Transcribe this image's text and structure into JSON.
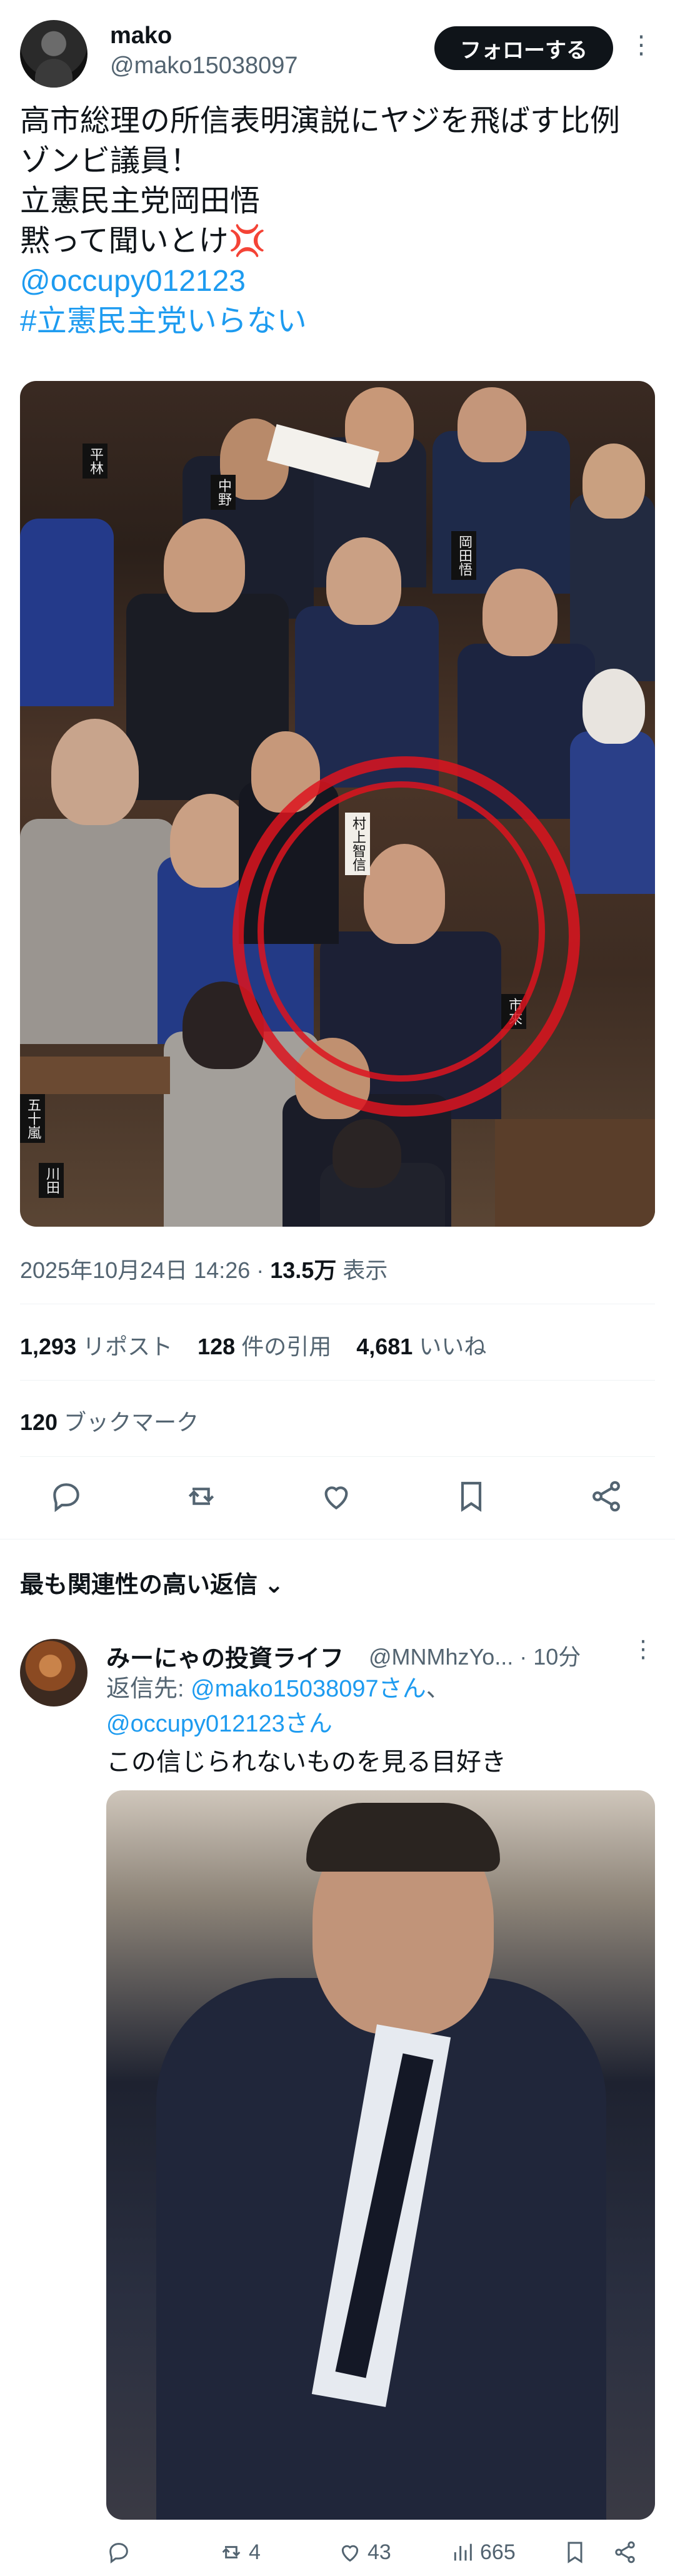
{
  "author": {
    "display_name": "mako",
    "handle": "@mako15038097",
    "follow_label": "フォローする",
    "more_label": "⋮"
  },
  "tweet": {
    "lines": [
      "高市総理の所信表明演説にヤジを飛ばす比例",
      "ゾンビ議員！",
      "立憲民主党岡田悟",
      "黙って聞いとけ💢"
    ],
    "mention": "@occupy012123",
    "hashtag": "#立憲民主党いらない"
  },
  "media_placards": [
    "平林",
    "中野",
    "岡田悟",
    "市來",
    "村上智信",
    "五十嵐",
    "川田"
  ],
  "meta": {
    "timestamp": "2025年10月24日 14:26 · ",
    "views_count": "13.5万",
    "views_label": " 表示"
  },
  "stats": {
    "reposts_count": "1,293",
    "reposts_label": " リポスト",
    "quotes_count": "128",
    "quotes_label": " 件の引用",
    "likes_count": "4,681",
    "likes_label": " いいね",
    "bookmarks_count": "120",
    "bookmarks_label": " ブックマーク"
  },
  "sort": {
    "label": "最も関連性の高い返信 ⌄"
  },
  "reply": {
    "display_name": "みーにゃの投資ライフ",
    "handle": "@MNMhzYo... · 10分",
    "more_label": "⋮",
    "reply_to_prefix": "返信先: ",
    "reply_to_1": "@mako15038097さん",
    "reply_to_sep": "、",
    "reply_to_2": "@occupy012123さん",
    "text": "この信じられないものを見る目好き",
    "reposts": "4",
    "likes": "43",
    "views": "665"
  },
  "colors": {
    "accent": "#1d9bf0",
    "text": "#0f1419",
    "secondary": "#536471"
  }
}
